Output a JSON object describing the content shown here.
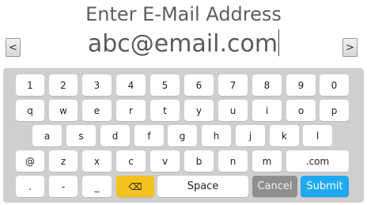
{
  "header": {
    "title": "Enter E-Mail Address"
  },
  "input": {
    "value": "abc@email.com",
    "left_arrow": "<",
    "right_arrow": ">"
  },
  "keyboard": {
    "row1": [
      "1",
      "2",
      "3",
      "4",
      "5",
      "6",
      "7",
      "8",
      "9",
      "0"
    ],
    "row2": [
      "q",
      "w",
      "e",
      "r",
      "t",
      "y",
      "u",
      "i",
      "o",
      "p"
    ],
    "row3": [
      "a",
      "s",
      "d",
      "f",
      "g",
      "h",
      "j",
      "k",
      "l"
    ],
    "row4": [
      "@",
      "z",
      "x",
      "c",
      "v",
      "b",
      "n",
      "m",
      ".com"
    ],
    "row5": {
      "dot": ".",
      "dash": "-",
      "underscore": "_",
      "backspace": "⌫",
      "space": "Space",
      "cancel": "Cancel",
      "submit": "Submit"
    }
  },
  "colors": {
    "backspace": "#f4c21c",
    "cancel": "#8f8f8f",
    "submit": "#1ea9f0",
    "keyboard_bg": "#cfcfcf"
  }
}
